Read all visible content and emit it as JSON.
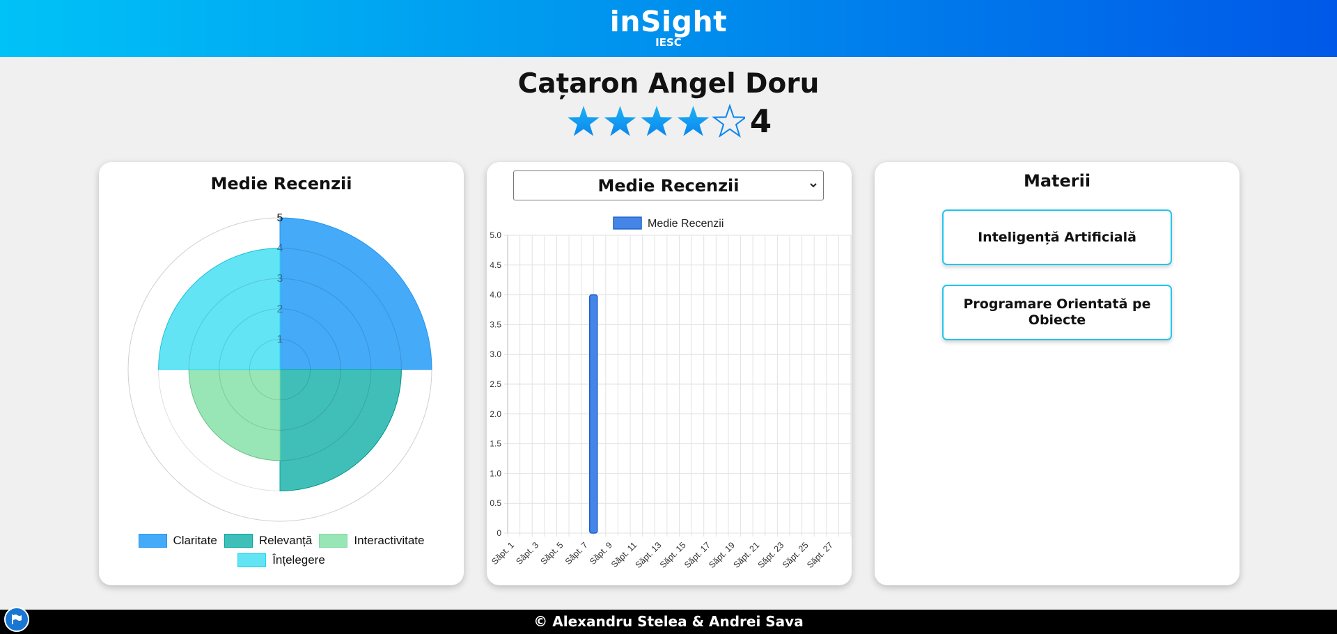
{
  "header": {
    "brand": "inSight",
    "subtitle": "IESC"
  },
  "professor": {
    "name": "Cațaron Angel Doru",
    "rating": 4,
    "rating_display": "4",
    "max_rating": 5
  },
  "colors": {
    "header_gradient": [
      "#00c2f7",
      "#0058e8"
    ],
    "star": "#0a86ee",
    "bar": "#4585e8",
    "polar": [
      "#2196f3",
      "#00a99d",
      "#7ddba0",
      "#21d9f3"
    ]
  },
  "left_card": {
    "title": "Medie Recenzii",
    "legend": [
      {
        "label": "Claritate",
        "color": "#45aaf8"
      },
      {
        "label": "Relevanță",
        "color": "#40bfb8"
      },
      {
        "label": "Interactivitate",
        "color": "#98e5b5"
      },
      {
        "label": "Înțelegere",
        "color": "#62e4f5"
      }
    ]
  },
  "middle_card": {
    "select": {
      "value": "Medie Recenzii"
    },
    "legend_label": "Medie Recenzii"
  },
  "right_card": {
    "title": "Materii",
    "subjects": [
      "Inteligență Artificială",
      "Programare Orientată pe Obiecte"
    ]
  },
  "footer": {
    "text": "© Alexandru Stelea & Andrei Sava"
  },
  "chart_data": [
    {
      "type": "polarArea",
      "categories": [
        "Claritate",
        "Relevanță",
        "Interactivitate",
        "Înțelegere"
      ],
      "values": [
        5,
        4,
        3,
        4
      ],
      "rlim": [
        0,
        5
      ],
      "ticks": [
        "1",
        "2",
        "3",
        "4",
        "5"
      ],
      "legend": "bottom"
    },
    {
      "type": "bar",
      "series": [
        {
          "name": "Medie Recenzii",
          "values": [
            0,
            0,
            0,
            4,
            0,
            0,
            0,
            0,
            0,
            0,
            0,
            0,
            0,
            0
          ]
        }
      ],
      "categories": [
        "Săpt. 1",
        "Săpt. 3",
        "Săpt. 5",
        "Săpt. 7",
        "Săpt. 9",
        "Săpt. 11",
        "Săpt. 13",
        "Săpt. 15",
        "Săpt. 17",
        "Săpt. 19",
        "Săpt. 21",
        "Săpt. 23",
        "Săpt. 25",
        "Săpt. 27"
      ],
      "ylim": [
        0,
        5
      ],
      "yticks": [
        "0",
        "0.5",
        "1.0",
        "1.5",
        "2.0",
        "2.5",
        "3.0",
        "3.5",
        "4.0",
        "4.5",
        "5.0"
      ],
      "grid": true,
      "legend": "top"
    }
  ]
}
